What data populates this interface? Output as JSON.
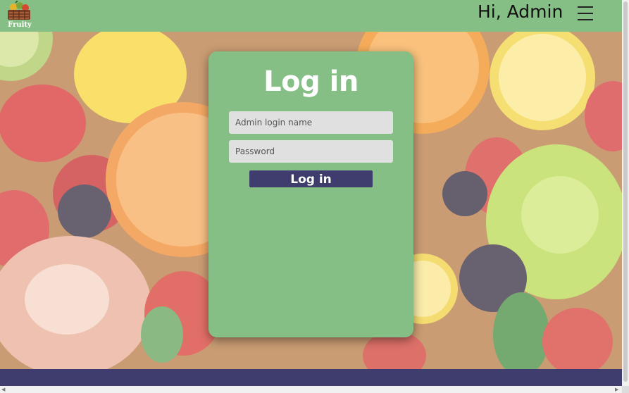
{
  "header": {
    "logo_text": "Fruity",
    "greeting": "Hi, Admin",
    "menu_icon": "hamburger-menu-icon"
  },
  "background": {
    "description_icon": "fruit-background-image"
  },
  "login": {
    "title": "Log in",
    "username_placeholder": "Admin login name",
    "username_value": "",
    "password_placeholder": "Password",
    "password_value": "",
    "submit_label": "Log in"
  },
  "colors": {
    "header_bg": "#86bf86",
    "card_bg": "#86bf86",
    "button_bg": "#3e3d6e",
    "footer_bg": "#3e3d6e",
    "input_bg": "#e0e0e0"
  }
}
